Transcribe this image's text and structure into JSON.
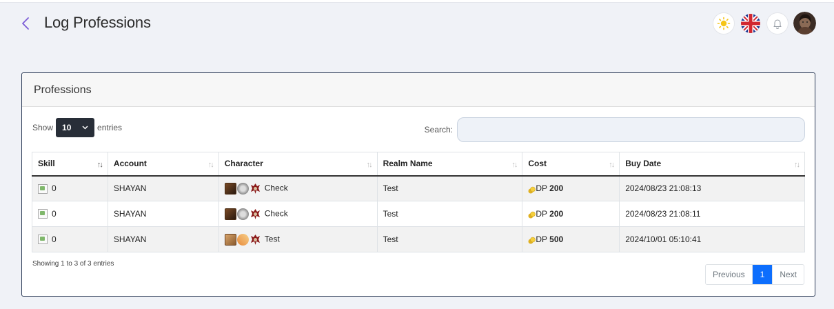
{
  "page": {
    "title": "Log Professions"
  },
  "header_icons": [
    "sun-icon",
    "uk-flag-icon",
    "bell-icon",
    "user-avatar"
  ],
  "card": {
    "title": "Professions"
  },
  "length": {
    "show_label": "Show",
    "value": "10",
    "entries_label": "entries"
  },
  "search": {
    "label": "Search:",
    "value": "",
    "placeholder": ""
  },
  "table": {
    "columns": [
      "Skill",
      "Account",
      "Character",
      "Realm Name",
      "Cost",
      "Buy Date"
    ],
    "rows": [
      {
        "skill": "0",
        "account": "SHAYAN",
        "character": "Check",
        "realm": "Test",
        "cost_prefix": "DP",
        "cost": "200",
        "date": "2024/08/23 21:08:13"
      },
      {
        "skill": "0",
        "account": "SHAYAN",
        "character": "Check",
        "realm": "Test",
        "cost_prefix": "DP",
        "cost": "200",
        "date": "2024/08/23 21:08:11"
      },
      {
        "skill": "0",
        "account": "SHAYAN",
        "character": "Test",
        "realm": "Test",
        "cost_prefix": "DP",
        "cost": "500",
        "date": "2024/10/01 05:10:41"
      }
    ]
  },
  "info": "Showing 1 to 3 of 3 entries",
  "pagination": {
    "previous": "Previous",
    "current": "1",
    "next": "Next"
  },
  "colors": {
    "accent": "#0d6efd",
    "back_arrow": "#7b5cd6",
    "select_bg": "#282e38"
  }
}
